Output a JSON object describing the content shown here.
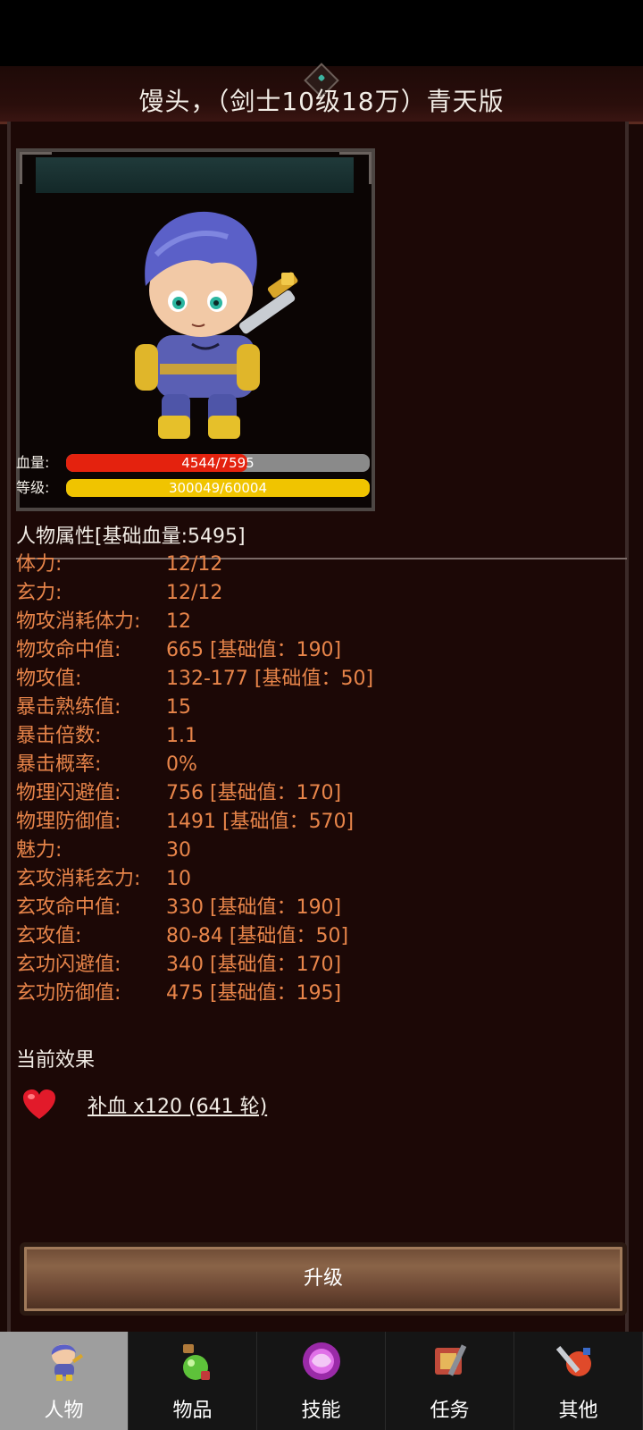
{
  "window": {
    "title": "馒头，（剑士10级18万）青天版"
  },
  "character": {
    "hp": {
      "label": "血量:",
      "text": "4544/7595",
      "fraction": 0.598,
      "color": "#e4220e"
    },
    "level": {
      "label": "等级:",
      "text": "300049/60004",
      "fraction": 1.0,
      "color": "#f0c400"
    }
  },
  "attributes": {
    "title": "人物属性[基础血量:5495]",
    "rows": [
      {
        "name": "体力:",
        "value": "12/12"
      },
      {
        "name": "玄力:",
        "value": "12/12"
      },
      {
        "name": "物攻消耗体力:",
        "value": "12"
      },
      {
        "name": "物攻命中值:",
        "value": "665 [基础值：190]"
      },
      {
        "name": "物攻值:",
        "value": "132-177 [基础值：50]"
      },
      {
        "name": "暴击熟练值:",
        "value": "15"
      },
      {
        "name": "暴击倍数:",
        "value": "1.1"
      },
      {
        "name": "暴击概率:",
        "value": "0%"
      },
      {
        "name": "物理闪避值:",
        "value": "756 [基础值：170]"
      },
      {
        "name": "物理防御值:",
        "value": "1491 [基础值：570]"
      },
      {
        "name": "魅力:",
        "value": "30"
      },
      {
        "name": "玄攻消耗玄力:",
        "value": "10"
      },
      {
        "name": "玄攻命中值:",
        "value": "330 [基础值：190]"
      },
      {
        "name": "玄攻值:",
        "value": "80-84 [基础值：50]"
      },
      {
        "name": "玄功闪避值:",
        "value": "340 [基础值：170]"
      },
      {
        "name": "玄功防御值:",
        "value": "475 [基础值：195]"
      }
    ]
  },
  "effects": {
    "title": "当前效果",
    "items": [
      {
        "icon": "heart-icon",
        "text": "补血 x120 (641 轮)"
      }
    ]
  },
  "upgrade": {
    "label": "升级"
  },
  "nav": {
    "items": [
      {
        "label": "人物",
        "icon": "character-icon",
        "active": true
      },
      {
        "label": "物品",
        "icon": "potion-icon",
        "active": false
      },
      {
        "label": "技能",
        "icon": "skill-orb-icon",
        "active": false
      },
      {
        "label": "任务",
        "icon": "quest-icon",
        "active": false
      },
      {
        "label": "其他",
        "icon": "other-icon",
        "active": false
      }
    ]
  },
  "colors": {
    "attribute_text": "#e8854a",
    "accent_teal": "#3cb3a0"
  }
}
